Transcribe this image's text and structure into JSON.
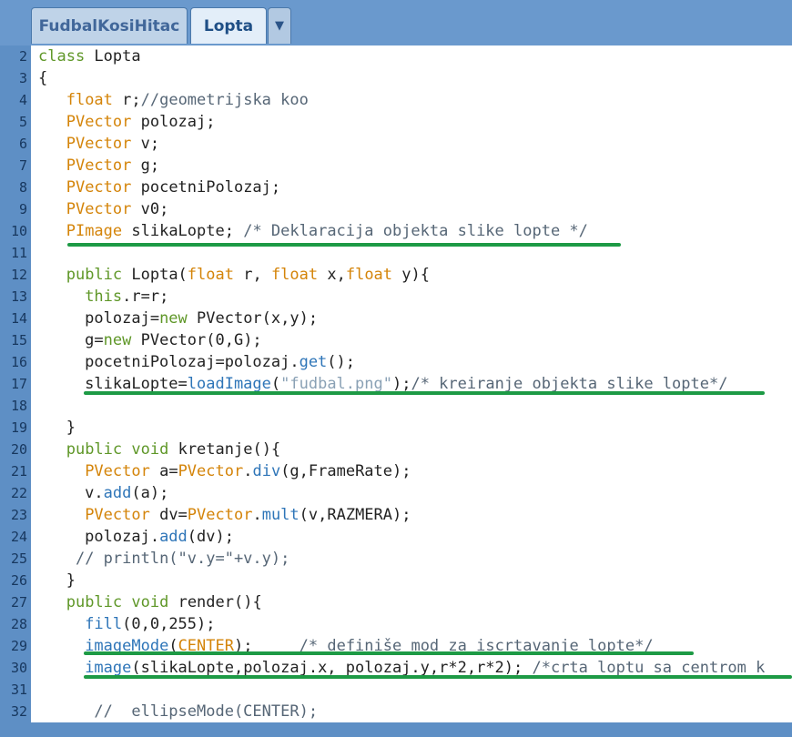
{
  "tabs": {
    "first_label": "FudbalKosiHitac",
    "active_label": "Lopta",
    "dropdown_glyph": "▼"
  },
  "lines": [
    {
      "num": "2",
      "tokens": [
        {
          "t": "kw",
          "s": "class"
        },
        {
          "t": "",
          "s": " Lopta"
        }
      ]
    },
    {
      "num": "3",
      "tokens": [
        {
          "t": "",
          "s": "{"
        }
      ]
    },
    {
      "num": "4",
      "tokens": [
        {
          "t": "",
          "s": "   "
        },
        {
          "t": "ty",
          "s": "float"
        },
        {
          "t": "",
          "s": " r;"
        },
        {
          "t": "cm",
          "s": "//geometrijska koo"
        }
      ]
    },
    {
      "num": "5",
      "tokens": [
        {
          "t": "",
          "s": "   "
        },
        {
          "t": "ty",
          "s": "PVector"
        },
        {
          "t": "",
          "s": " polozaj;"
        }
      ]
    },
    {
      "num": "6",
      "tokens": [
        {
          "t": "",
          "s": "   "
        },
        {
          "t": "ty",
          "s": "PVector"
        },
        {
          "t": "",
          "s": " v;"
        }
      ]
    },
    {
      "num": "7",
      "tokens": [
        {
          "t": "",
          "s": "   "
        },
        {
          "t": "ty",
          "s": "PVector"
        },
        {
          "t": "",
          "s": " g;"
        }
      ]
    },
    {
      "num": "8",
      "tokens": [
        {
          "t": "",
          "s": "   "
        },
        {
          "t": "ty",
          "s": "PVector"
        },
        {
          "t": "",
          "s": " pocetniPolozaj;"
        }
      ]
    },
    {
      "num": "9",
      "tokens": [
        {
          "t": "",
          "s": "   "
        },
        {
          "t": "ty",
          "s": "PVector"
        },
        {
          "t": "",
          "s": " v0;"
        }
      ]
    },
    {
      "num": "10",
      "tokens": [
        {
          "t": "",
          "s": "   "
        },
        {
          "t": "ty",
          "s": "PImage"
        },
        {
          "t": "",
          "s": " slikaLopte; "
        },
        {
          "t": "cm",
          "s": "/* Deklaracija objekta slike lopte */"
        }
      ]
    },
    {
      "num": "11",
      "tokens": []
    },
    {
      "num": "12",
      "tokens": [
        {
          "t": "",
          "s": "   "
        },
        {
          "t": "kw",
          "s": "public"
        },
        {
          "t": "",
          "s": " Lopta("
        },
        {
          "t": "ty",
          "s": "float"
        },
        {
          "t": "",
          "s": " r, "
        },
        {
          "t": "ty",
          "s": "float"
        },
        {
          "t": "",
          "s": " x,"
        },
        {
          "t": "ty",
          "s": "float"
        },
        {
          "t": "",
          "s": " y){"
        }
      ]
    },
    {
      "num": "13",
      "tokens": [
        {
          "t": "",
          "s": "     "
        },
        {
          "t": "kw",
          "s": "this"
        },
        {
          "t": "",
          "s": ".r=r;"
        }
      ]
    },
    {
      "num": "14",
      "tokens": [
        {
          "t": "",
          "s": "     polozaj="
        },
        {
          "t": "kw",
          "s": "new"
        },
        {
          "t": "",
          "s": " PVector(x,y);"
        }
      ]
    },
    {
      "num": "15",
      "tokens": [
        {
          "t": "",
          "s": "     g="
        },
        {
          "t": "kw",
          "s": "new"
        },
        {
          "t": "",
          "s": " PVector(0,G);"
        }
      ]
    },
    {
      "num": "16",
      "tokens": [
        {
          "t": "",
          "s": "     pocetniPolozaj=polozaj."
        },
        {
          "t": "fn",
          "s": "get"
        },
        {
          "t": "",
          "s": "();"
        }
      ]
    },
    {
      "num": "17",
      "tokens": [
        {
          "t": "",
          "s": "     slikaLopte="
        },
        {
          "t": "fn",
          "s": "loadImage"
        },
        {
          "t": "",
          "s": "("
        },
        {
          "t": "str",
          "s": "\"fudbal.png\""
        },
        {
          "t": "",
          "s": ");"
        },
        {
          "t": "cm",
          "s": "/* kreiranje objekta slike lopte*/"
        }
      ]
    },
    {
      "num": "18",
      "tokens": []
    },
    {
      "num": "19",
      "tokens": [
        {
          "t": "",
          "s": "   }"
        }
      ]
    },
    {
      "num": "20",
      "tokens": [
        {
          "t": "",
          "s": "   "
        },
        {
          "t": "kw",
          "s": "public"
        },
        {
          "t": "",
          "s": " "
        },
        {
          "t": "kw",
          "s": "void"
        },
        {
          "t": "",
          "s": " kretanje(){"
        }
      ]
    },
    {
      "num": "21",
      "tokens": [
        {
          "t": "",
          "s": "     "
        },
        {
          "t": "ty",
          "s": "PVector"
        },
        {
          "t": "",
          "s": " a="
        },
        {
          "t": "ty",
          "s": "PVector"
        },
        {
          "t": "",
          "s": "."
        },
        {
          "t": "fn",
          "s": "div"
        },
        {
          "t": "",
          "s": "(g,FrameRate);"
        }
      ]
    },
    {
      "num": "22",
      "tokens": [
        {
          "t": "",
          "s": "     v."
        },
        {
          "t": "fn",
          "s": "add"
        },
        {
          "t": "",
          "s": "(a);"
        }
      ]
    },
    {
      "num": "23",
      "tokens": [
        {
          "t": "",
          "s": "     "
        },
        {
          "t": "ty",
          "s": "PVector"
        },
        {
          "t": "",
          "s": " dv="
        },
        {
          "t": "ty",
          "s": "PVector"
        },
        {
          "t": "",
          "s": "."
        },
        {
          "t": "fn",
          "s": "mult"
        },
        {
          "t": "",
          "s": "(v,RAZMERA);"
        }
      ]
    },
    {
      "num": "24",
      "tokens": [
        {
          "t": "",
          "s": "     polozaj."
        },
        {
          "t": "fn",
          "s": "add"
        },
        {
          "t": "",
          "s": "(dv);"
        }
      ]
    },
    {
      "num": "25",
      "tokens": [
        {
          "t": "",
          "s": "    "
        },
        {
          "t": "cm",
          "s": "// println(\"v.y=\"+v.y);"
        }
      ]
    },
    {
      "num": "26",
      "tokens": [
        {
          "t": "",
          "s": "   }"
        }
      ]
    },
    {
      "num": "27",
      "tokens": [
        {
          "t": "",
          "s": "   "
        },
        {
          "t": "kw",
          "s": "public"
        },
        {
          "t": "",
          "s": " "
        },
        {
          "t": "kw",
          "s": "void"
        },
        {
          "t": "",
          "s": " render(){"
        }
      ]
    },
    {
      "num": "28",
      "tokens": [
        {
          "t": "",
          "s": "     "
        },
        {
          "t": "fn",
          "s": "fill"
        },
        {
          "t": "",
          "s": "(0,0,255);"
        }
      ]
    },
    {
      "num": "29",
      "tokens": [
        {
          "t": "",
          "s": "     "
        },
        {
          "t": "fn",
          "s": "imageMode"
        },
        {
          "t": "",
          "s": "("
        },
        {
          "t": "ty",
          "s": "CENTER"
        },
        {
          "t": "",
          "s": ");     "
        },
        {
          "t": "cm",
          "s": "/* definiše mod za iscrtavanje lopte*/"
        }
      ]
    },
    {
      "num": "30",
      "tokens": [
        {
          "t": "",
          "s": "     "
        },
        {
          "t": "fn",
          "s": "image"
        },
        {
          "t": "",
          "s": "(slikaLopte,polozaj.x, polozaj.y,r*2,r*2); "
        },
        {
          "t": "cm",
          "s": "/*crta loptu sa centrom k"
        }
      ]
    },
    {
      "num": "31",
      "tokens": []
    },
    {
      "num": "32",
      "tokens": [
        {
          "t": "",
          "s": "      "
        },
        {
          "t": "cm",
          "s": "//  ellipseMode(CENTER);"
        }
      ]
    }
  ]
}
